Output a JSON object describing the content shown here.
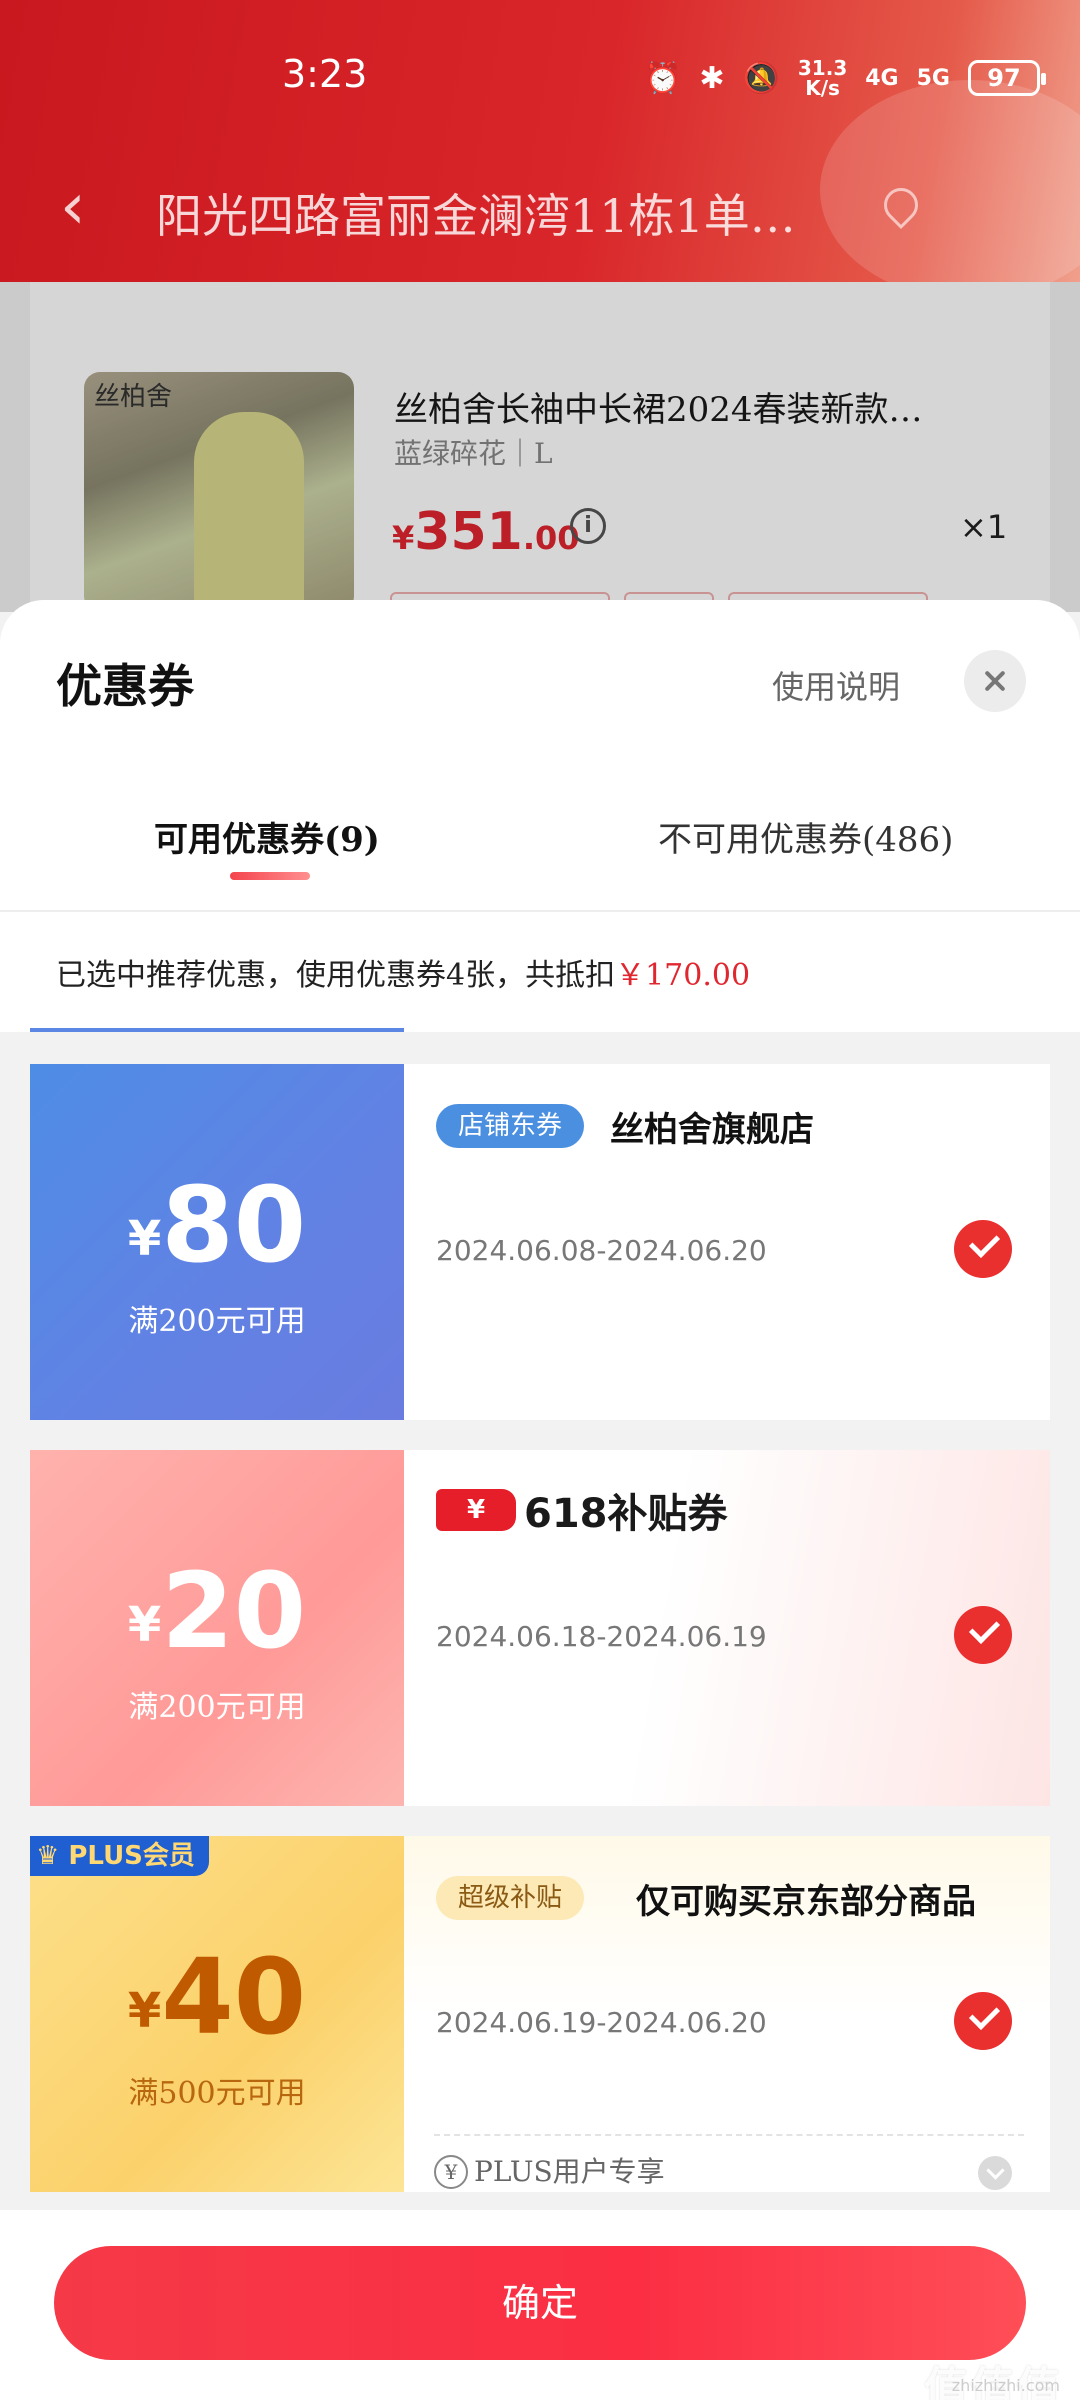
{
  "status_bar": {
    "time": "3:23",
    "net_speed_top": "31.3",
    "net_speed_bottom": "K/s",
    "signal_1": "4G",
    "signal_2": "5G",
    "battery": "97"
  },
  "header": {
    "address": "阳光四路富丽金澜湾11栋1单…"
  },
  "product": {
    "title": "丝柏舍长袖中长裙2024春装新款…",
    "spec": "蓝绿碎花｜L",
    "price_symbol": "¥",
    "price_int": "351",
    "price_dec": ".00",
    "quantity": "×1",
    "image_brand": "丝柏舍"
  },
  "sheet": {
    "title": "优惠券",
    "usage_link": "使用说明",
    "tabs": [
      {
        "label": "可用优惠券(9)",
        "active": true
      },
      {
        "label": "不可用优惠券(486)",
        "active": false
      }
    ],
    "summary_text": "已选中推荐优惠，使用优惠券4张，共抵扣",
    "summary_amount": "￥170.00"
  },
  "coupons": [
    {
      "currency": "¥",
      "amount": "80",
      "condition": "满200元可用",
      "badge": "店铺东券",
      "name": "丝柏舍旗舰店",
      "date": "2024.06.08-2024.06.20",
      "selected": true,
      "colors": {
        "left": "#5f83e4",
        "badge": "#4b8fe0"
      }
    },
    {
      "currency": "¥",
      "amount": "20",
      "condition": "满200元可用",
      "logo_yen": "¥",
      "name": "618补贴券",
      "date": "2024.06.18-2024.06.19",
      "selected": true,
      "colors": {
        "left": "#ff9a98",
        "logo": "#e61e2a"
      }
    },
    {
      "currency": "¥",
      "amount": "40",
      "condition": "满500元可用",
      "corner_badge": "PLUS会员",
      "badge": "超级补贴",
      "name": "仅可购买京东部分商品",
      "date": "2024.06.19-2024.06.20",
      "note_icon": "¥",
      "note": "PLUS用户专享",
      "selected": true,
      "colors": {
        "left": "#fbd16b",
        "text": "#c05a00"
      }
    }
  ],
  "footer": {
    "confirm_label": "确定"
  },
  "watermark": {
    "main": "值值值",
    "sub": "zhizhizhi.com"
  },
  "theme": {
    "accent": "#e0262f",
    "confirm_gradient_start": "#f53947",
    "confirm_gradient_end": "#ff4e57"
  },
  "icons": [
    "back-arrow-icon",
    "location-pin-icon",
    "info-icon",
    "close-icon",
    "check-icon",
    "crown-icon",
    "yen-circle-icon",
    "chevron-down-icon",
    "alarm-icon",
    "bluetooth-icon",
    "mute-icon"
  ]
}
